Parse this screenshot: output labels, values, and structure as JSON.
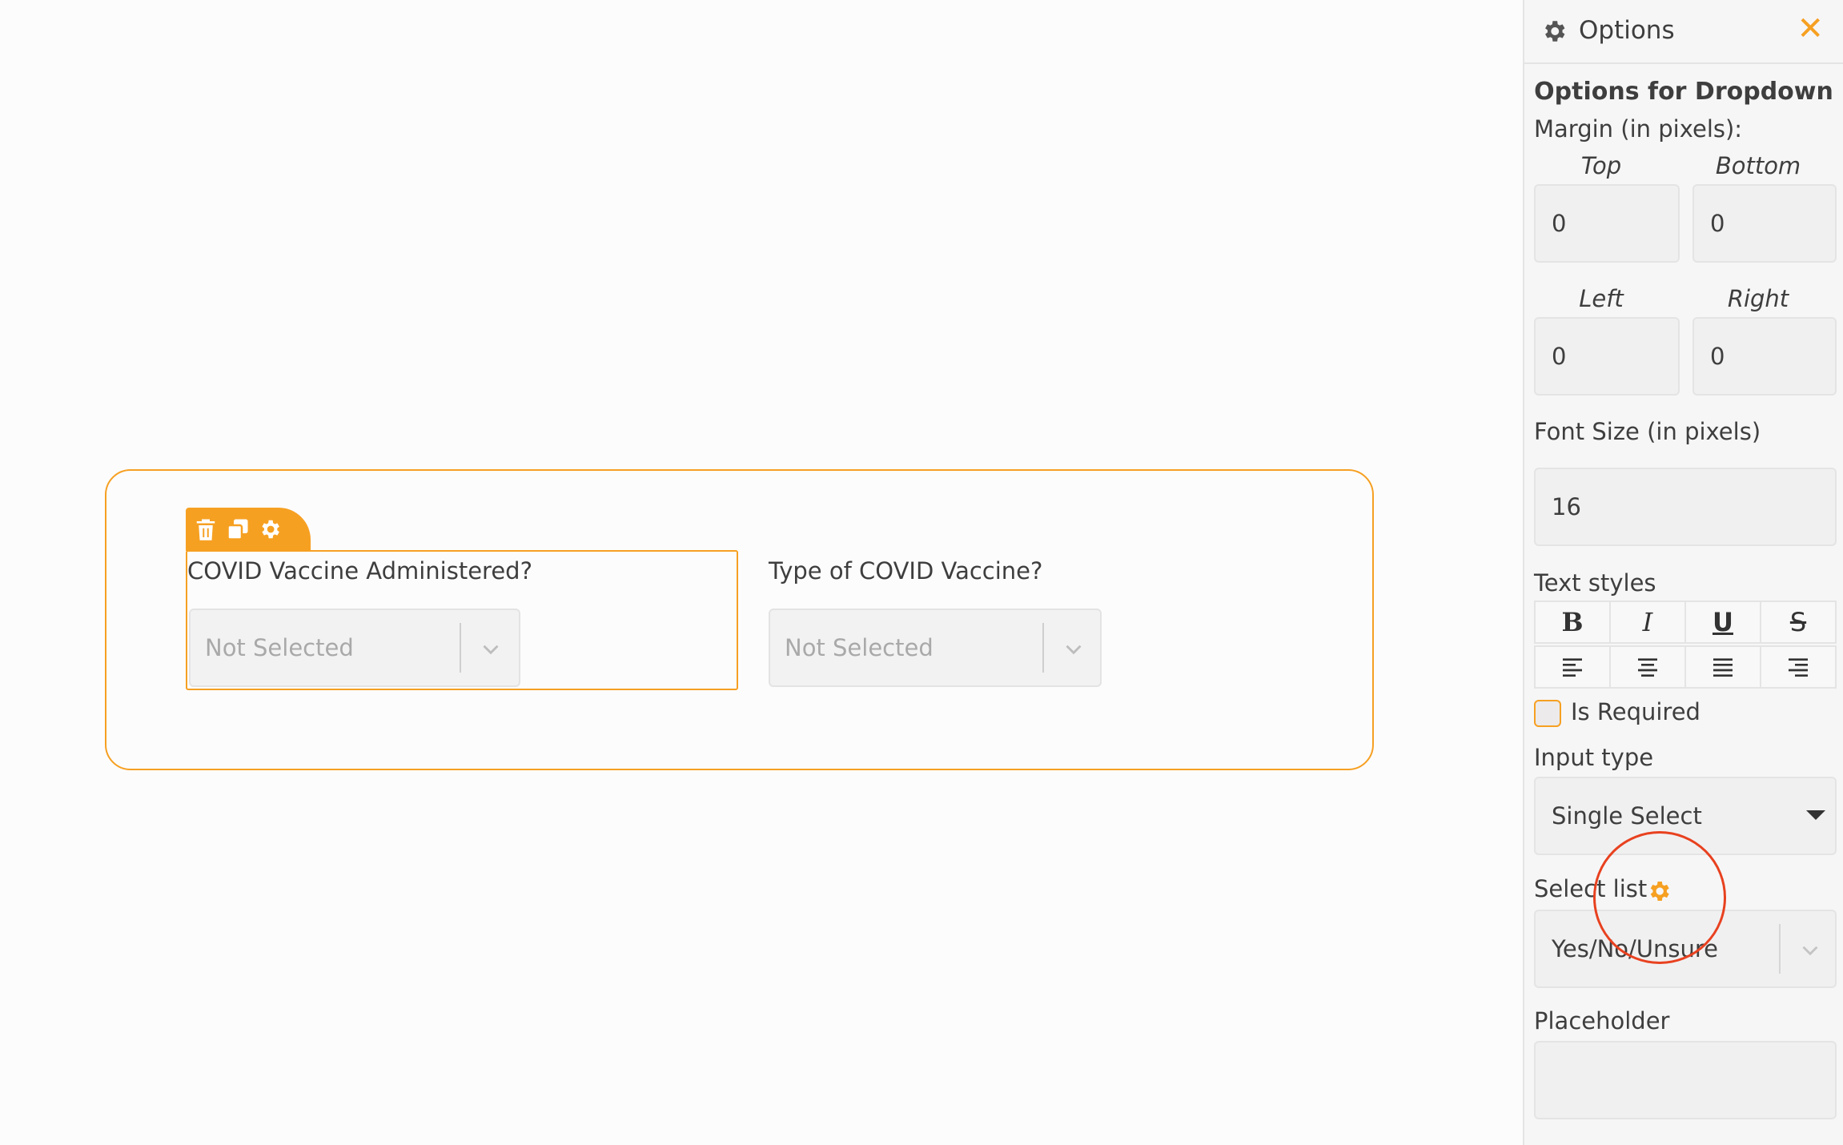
{
  "canvas": {
    "fields": [
      {
        "label": "COVID Vaccine Administered?",
        "placeholder": "Not Selected",
        "selected": true
      },
      {
        "label": "Type of COVID Vaccine?",
        "placeholder": "Not Selected",
        "selected": false
      }
    ],
    "toolbar_icons": [
      "trash-icon",
      "duplicate-icon",
      "gear-icon"
    ]
  },
  "panel": {
    "title": "Options",
    "heading": "Options for Dropdown",
    "margin_label": "Margin (in pixels):",
    "margin": {
      "top_label": "Top",
      "top_value": "0",
      "bottom_label": "Bottom",
      "bottom_value": "0",
      "left_label": "Left",
      "left_value": "0",
      "right_label": "Right",
      "right_value": "0"
    },
    "font_size_label": "Font Size (in pixels)",
    "font_size_value": "16",
    "text_styles_label": "Text styles",
    "style_buttons": [
      "B",
      "I",
      "U",
      "S"
    ],
    "align_buttons": [
      "align-left-icon",
      "align-center-icon",
      "align-justify-icon",
      "align-right-icon"
    ],
    "is_required_label": "Is Required",
    "is_required": false,
    "input_type_label": "Input type",
    "input_type_value": "Single Select",
    "select_list_label": "Select list",
    "select_list_value": "Yes/No/Unsure",
    "placeholder_label": "Placeholder",
    "placeholder_value": ""
  },
  "colors": {
    "accent": "#f6a022",
    "annotation": "#e8411f",
    "text": "#3e3e3e"
  }
}
